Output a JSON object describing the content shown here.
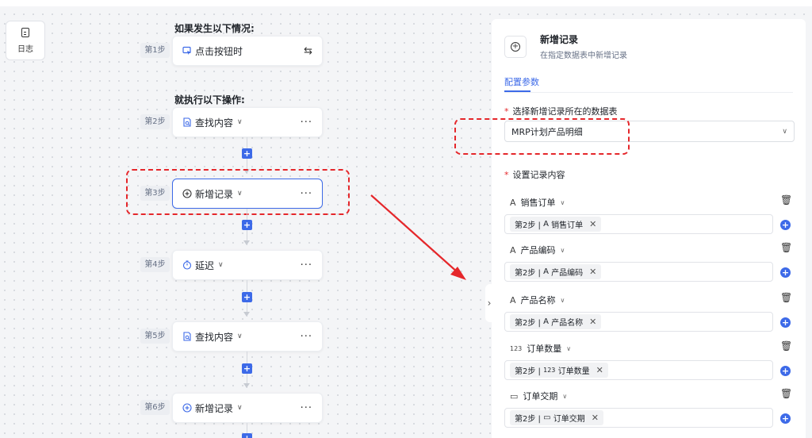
{
  "log": {
    "label": "日志",
    "icon": "log-icon"
  },
  "flow": {
    "trigger_title": "如果发生以下情况:",
    "action_title": "就执行以下操作:",
    "steps": [
      {
        "badge": "第1步",
        "label": "点击按钮时",
        "icon": "cursor-click-icon"
      },
      {
        "badge": "第2步",
        "label": "查找内容",
        "icon": "search-doc-icon"
      },
      {
        "badge": "第3步",
        "label": "新增记录",
        "icon": "add-circle-icon"
      },
      {
        "badge": "第4步",
        "label": "延迟",
        "icon": "timer-icon"
      },
      {
        "badge": "第5步",
        "label": "查找内容",
        "icon": "search-doc-icon"
      },
      {
        "badge": "第6步",
        "label": "新增记录",
        "icon": "add-circle-icon"
      }
    ],
    "more_label": "···",
    "plus_label": "+"
  },
  "panel": {
    "title": "新增记录",
    "subtitle": "在指定数据表中新增记录",
    "tab": "配置参数",
    "table_label": "选择新增记录所在的数据表",
    "table_value": "MRP计划产品明细",
    "content_label": "设置记录内容",
    "required_mark": "*",
    "fields": [
      {
        "icon_text": "A",
        "name": "销售订单",
        "chip_prefix": "第2步 |",
        "chip_icon": "A",
        "chip_name": "销售订单"
      },
      {
        "icon_text": "A",
        "name": "产品编码",
        "chip_prefix": "第2步 |",
        "chip_icon": "A",
        "chip_name": "产品编码"
      },
      {
        "icon_text": "A",
        "name": "产品名称",
        "chip_prefix": "第2步 |",
        "chip_icon": "A",
        "chip_name": "产品名称"
      },
      {
        "icon_text": "123",
        "name": "订单数量",
        "chip_prefix": "第2步 |",
        "chip_icon": "123",
        "chip_name": "订单数量"
      },
      {
        "icon_text": "▭",
        "name": "订单交期",
        "chip_prefix": "第2步 |",
        "chip_icon": "▭",
        "chip_name": "订单交期"
      }
    ]
  },
  "colors": {
    "accent": "#3d6ae8",
    "highlight": "#e5272b"
  }
}
